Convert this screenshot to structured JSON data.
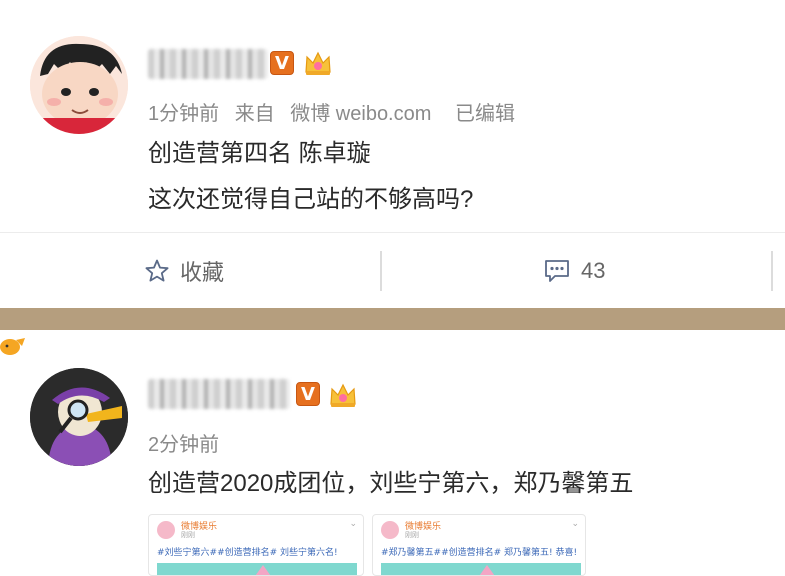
{
  "posts": [
    {
      "meta": {
        "time": "1分钟前",
        "from": "来自",
        "source": "微博 weibo.com",
        "edited": "已编辑"
      },
      "content_lines": [
        "创造营第四名 陈卓璇",
        "这次还觉得自己站的不够高吗?"
      ],
      "actions": {
        "favorite_label": "收藏",
        "comment_count": "43"
      },
      "badges": {
        "verified": "V",
        "icon": "crown-icon"
      }
    },
    {
      "meta": {
        "time": "2分钟前"
      },
      "content_lines": [
        "创造营2020成团位，刘些宁第六，郑乃馨第五"
      ],
      "badges": {
        "verified": "V",
        "icon": "crown-icon"
      },
      "attachments": [
        {
          "name": "微博娱乐",
          "sub": "刚刚",
          "text": "#刘些宁第六##创造营排名# 刘些宁第六名!"
        },
        {
          "name": "微博娱乐",
          "sub": "刚刚",
          "text": "#郑乃馨第五##创造营排名# 郑乃馨第五! 恭喜!"
        }
      ]
    }
  ],
  "colors": {
    "verified_badge": "#e6701f",
    "separator_band": "#b59e7e",
    "meta_text": "#8a8a8a"
  }
}
